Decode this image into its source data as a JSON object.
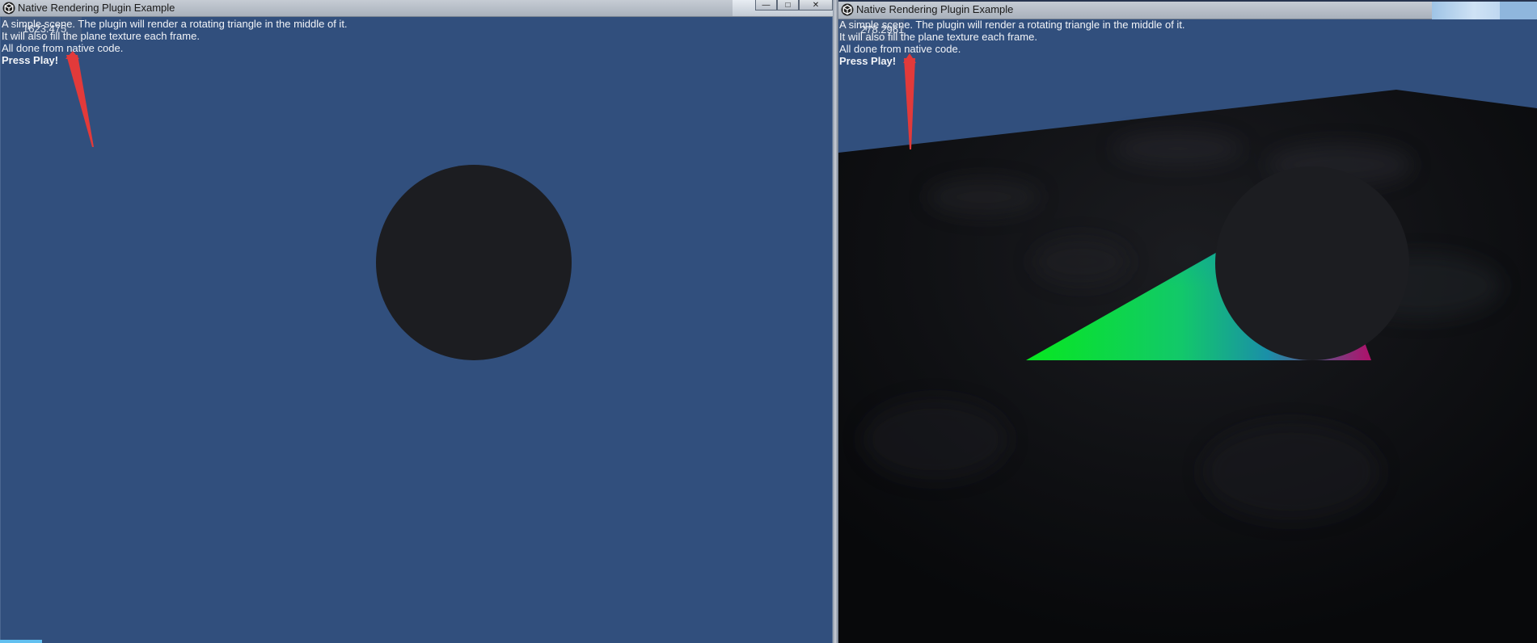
{
  "left_window": {
    "title": "Native Rendering Plugin Example",
    "controls": {
      "minimize": "—",
      "maximize": "□",
      "close": "✕"
    },
    "counter": "1623.475",
    "text_lines": [
      "A simple scene. The plugin will render a rotating triangle in the middle of it.",
      "It will also fill the plane texture each frame.",
      "All done from native code."
    ],
    "press_play": "Press Play!"
  },
  "right_window": {
    "title": "Native Rendering Plugin Example",
    "counter": "278.2961",
    "text_lines": [
      "A simple scene. The plugin will render a rotating triangle in the middle of it.",
      "It will also fill the plane texture each frame.",
      "All done from native code."
    ],
    "press_play": "Press Play!"
  },
  "colors": {
    "sky_blue": "#314f7d",
    "sphere": "#1c1d21",
    "arrow_red": "#e23a3a",
    "triangle_green": "#07e81f",
    "triangle_cyan": "#0f8fb4",
    "triangle_magenta": "#b0106a"
  }
}
